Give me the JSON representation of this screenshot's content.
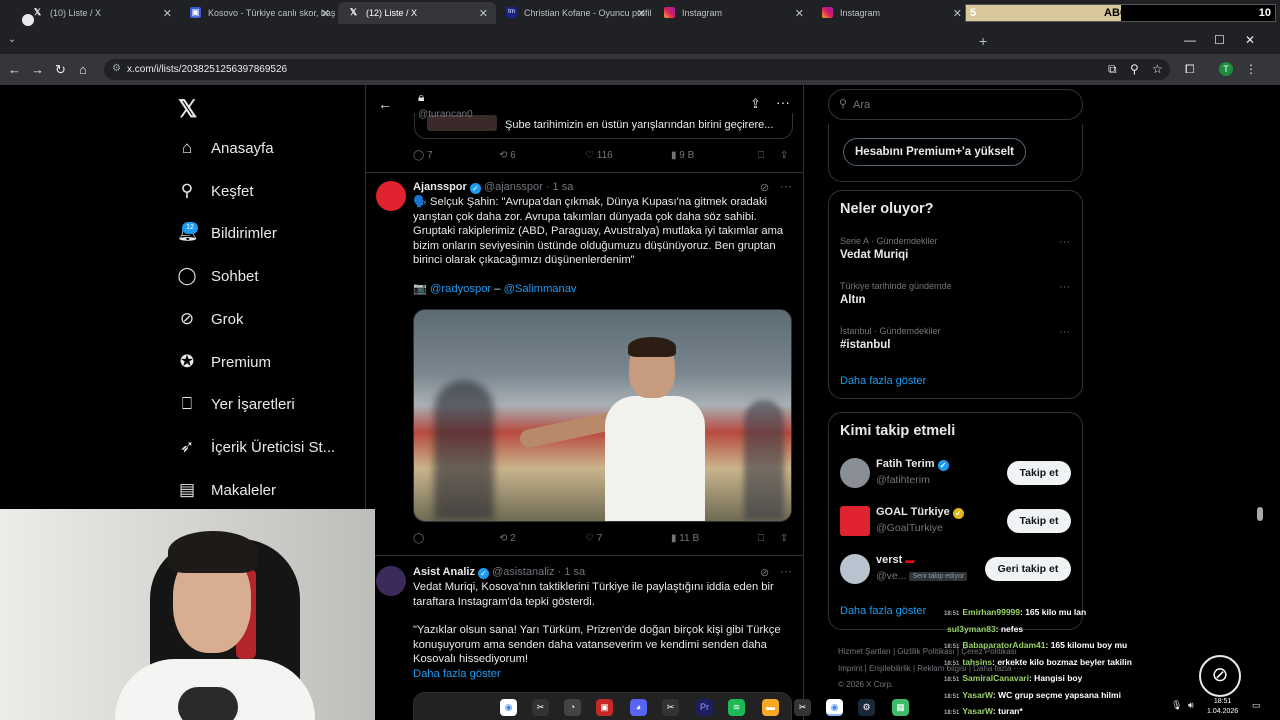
{
  "browser": {
    "tabs": [
      {
        "label": "(10) Liste / X",
        "active": false
      },
      {
        "label": "Kosovo - Türkiye canlı skor, baş",
        "active": false
      },
      {
        "label": "(12) Liste / X",
        "active": true
      },
      {
        "label": "Christian Kofane - Oyuncu profil",
        "active": false
      },
      {
        "label": "Instagram",
        "active": false
      },
      {
        "label": "Instagram",
        "active": false
      }
    ],
    "url": "x.com/i/lists/2038251256397869526",
    "profile_initial": "T"
  },
  "abone_bar": {
    "left": "5",
    "label": "ABONE..",
    "right": "10",
    "progress": 0.5
  },
  "nav": {
    "items": [
      {
        "label": "Anasayfa",
        "icon": "home-icon",
        "glyph": "⌂"
      },
      {
        "label": "Keşfet",
        "icon": "search-icon",
        "glyph": "⚲"
      },
      {
        "label": "Bildirimler",
        "icon": "bell-icon",
        "glyph": "🔔︎"
      },
      {
        "label": "Sohbet",
        "icon": "chat-icon",
        "glyph": "◯"
      },
      {
        "label": "Grok",
        "icon": "grok-icon",
        "glyph": "⊘"
      },
      {
        "label": "Premium",
        "icon": "verified-icon",
        "glyph": "✪"
      },
      {
        "label": "Yer İşaretleri",
        "icon": "bookmark-icon",
        "glyph": "⎕"
      },
      {
        "label": "İçerik Üreticisi St...",
        "icon": "rocket-icon",
        "glyph": "➶"
      },
      {
        "label": "Makaleler",
        "icon": "article-icon",
        "glyph": "▤"
      }
    ],
    "notif_badge": "12"
  },
  "top": {
    "handle": "@turancan0",
    "quoted_text": "Şube tarihimizin en üstün yarışlarından birini geçirere..."
  },
  "actions1": {
    "reply": "7",
    "repost": "6",
    "like": "116",
    "views": "9 B"
  },
  "tweet1": {
    "name": "Ajansspor",
    "handle": "@ajansspor · 1 sa",
    "text1": "🗣️ Selçuk Şahin: \"Avrupa'dan çıkmak, Dünya Kupası'na gitmek oradaki yarıştan çok daha zor. Avrupa takımları dünyada çok daha söz sahibi. Gruptaki rakiplerimiz (ABD, Paraguay, Avustralya) mutlaka iyi takımlar ama bizim onların seviyesinin üstünde olduğumuzu düşünüyoruz. Ben gruptan birinci olarak çıkacağımızı düşünenlerdenim\"",
    "credit_prefix": "📷",
    "credit1": "@radyospor",
    "credit_sep": " – ",
    "credit2": "@Salimmanav"
  },
  "actions2": {
    "reply": "",
    "repost": "2",
    "like": "7",
    "views": "11 B"
  },
  "tweet2": {
    "name": "Asist Analiz",
    "handle": "@asistanaliz · 1 sa",
    "text1": "Vedat Muriqi, Kosova'nın taktiklerini Türkiye ile paylaştığını iddia eden bir taraftara Instagram'da tepki gösterdi.",
    "text2": "\"Yazıklar olsun sana! Yarı Türküm, Prizren'de doğan birçok kişi gibi Türkçe konuşuyorum ama senden daha vatanseverim ve kendimi senden daha Kosovalı hissediyorum!",
    "more": "Daha fazla göster"
  },
  "sidebar": {
    "search_placeholder": "Ara",
    "premium_btn": "Hesabını Premium+'a yükselt",
    "trends_title": "Neler oluyor?",
    "trends": [
      {
        "category": "Serie A · Gündemdekiler",
        "name": "Vedat Muriqi"
      },
      {
        "category": "Türkiye tarihinde gündemde",
        "name": "Altın"
      },
      {
        "category": "İstanbul · Gündemdekiler",
        "name": "#istanbul"
      }
    ],
    "trends_more": "Daha fazla göster",
    "who_title": "Kimi takip etmeli",
    "who": [
      {
        "name": "Fatih Terim",
        "handle": "@fatihterim",
        "btn": "Takip et"
      },
      {
        "name": "GOAL Türkiye",
        "handle": "@GoalTurkiye",
        "btn": "Takip et"
      },
      {
        "name": "verst",
        "handle": "@ve...",
        "tag": "Seni takip ediyor",
        "btn": "Geri takip et"
      }
    ],
    "who_more": "Daha fazla göster",
    "footer1": "Hizmet Şartları  |  Gizlilik Politikası  |  Çerez Politikası",
    "footer2": "Imprint  |  Erişilebilirlik  |  Reklam bilgisi  |  Daha fazla ···",
    "footer3": "© 2026 X Corp."
  },
  "chat": [
    {
      "time": "18:51",
      "user": "Emirhan99999",
      "msg": ": 165 kilo mu lan"
    },
    {
      "time": "",
      "user": "sul3yman83",
      "msg": ": nefes"
    },
    {
      "time": "18:51",
      "user": "BabaparatorAdam41",
      "msg": ": 165 kilomu boy mu"
    },
    {
      "time": "18:51",
      "user": "tahsins",
      "msg": ": erkekte kilo bozmaz beyler takilin"
    },
    {
      "time": "18:51",
      "user": "SamiralCanavari",
      "msg": ": Hangisi boy"
    },
    {
      "time": "18:51",
      "user": "YasarW",
      "msg": ": WC grup seçme yapsana hilmi"
    },
    {
      "time": "18:51",
      "user": "YasarW",
      "msg": ": turan*"
    }
  ],
  "clock": {
    "time": "18:51",
    "date": "1.04.2026"
  },
  "colors": {
    "accent": "#1d9bf0",
    "background": "#000000",
    "border": "#2f3336"
  }
}
